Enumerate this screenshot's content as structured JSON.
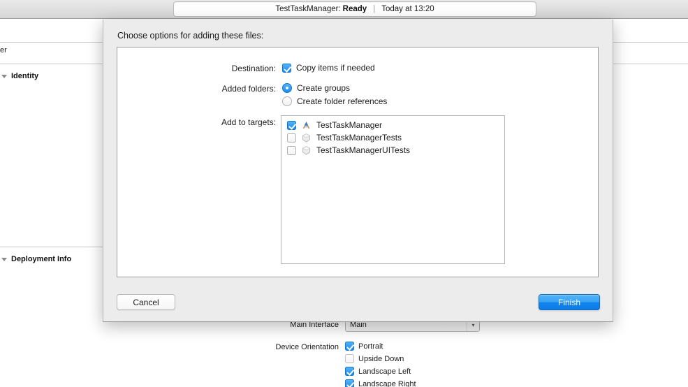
{
  "toolbar": {
    "status": {
      "scheme": "TestTaskManager:",
      "state": "Ready",
      "separator": "|",
      "time": "Today at 13:20"
    }
  },
  "background": {
    "clipped_label": "er",
    "sections": [
      {
        "label": "Identity"
      },
      {
        "label": "Deployment Info"
      }
    ],
    "main_interface": {
      "label": "Main Interface",
      "value": "Main",
      "arrow": "chevron-down-icon"
    },
    "device_orientation": {
      "label": "Device Orientation",
      "options": [
        {
          "label": "Portrait",
          "checked": true
        },
        {
          "label": "Upside Down",
          "checked": false
        },
        {
          "label": "Landscape Left",
          "checked": true
        },
        {
          "label": "Landscape Right",
          "checked": true
        }
      ]
    }
  },
  "dialog": {
    "title": "Choose options for adding these files:",
    "destination": {
      "label": "Destination:",
      "option": {
        "label": "Copy items if needed",
        "checked": true
      }
    },
    "added_folders": {
      "label": "Added folders:",
      "options": [
        {
          "label": "Create groups",
          "selected": true
        },
        {
          "label": "Create folder references",
          "selected": false
        }
      ]
    },
    "add_to_targets": {
      "label": "Add to targets:",
      "targets": [
        {
          "name": "TestTaskManager",
          "checked": true,
          "icon": "xcode-app-target-icon"
        },
        {
          "name": "TestTaskManagerTests",
          "checked": false,
          "icon": "test-bundle-icon"
        },
        {
          "name": "TestTaskManagerUITests",
          "checked": false,
          "icon": "test-bundle-icon"
        }
      ]
    },
    "buttons": {
      "cancel": "Cancel",
      "finish": "Finish"
    }
  },
  "colors": {
    "accent_blue": "#1b8bef",
    "default_button_blue": "#0d7ae5",
    "sheet_background": "#ececec",
    "panel_white": "#ffffff"
  }
}
